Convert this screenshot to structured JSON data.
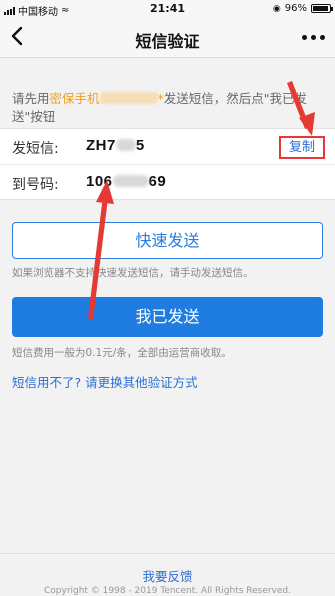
{
  "status_bar": {
    "carrier": "中国移动",
    "time": "21:41",
    "battery": "96%",
    "battery_level": 0.96
  },
  "nav": {
    "back_icon": "chevron-left-icon",
    "title": "短信验证",
    "more_icon": "more-dots-icon"
  },
  "instruction": {
    "prefix": "请先用",
    "highlight": "密保手机",
    "suffix_1": "发送短信，然后点\"我已发",
    "suffix_2": "送\"按钮"
  },
  "sms": {
    "send_label": "发短信:",
    "send_value_start": "ZH7",
    "send_value_end": "5",
    "copy_label": "复制",
    "to_label": "到号码:",
    "to_value_start": "106",
    "to_value_end": "69"
  },
  "buttons": {
    "quick_send": "快速发送",
    "quick_send_hint": "如果浏览器不支持快速发送短信，请手动发送短信。",
    "sent": "我已发送",
    "fee_note": "短信费用一般为0.1元/条，全部由运营商收取。"
  },
  "links": {
    "alternative": "短信用不了? 请更换其他验证方式",
    "feedback": "我要反馈"
  },
  "footer": {
    "copyright": "Copyright © 1998 - 2019 Tencent. All Rights Reserved."
  },
  "annotation": {
    "color": "#e53935"
  }
}
